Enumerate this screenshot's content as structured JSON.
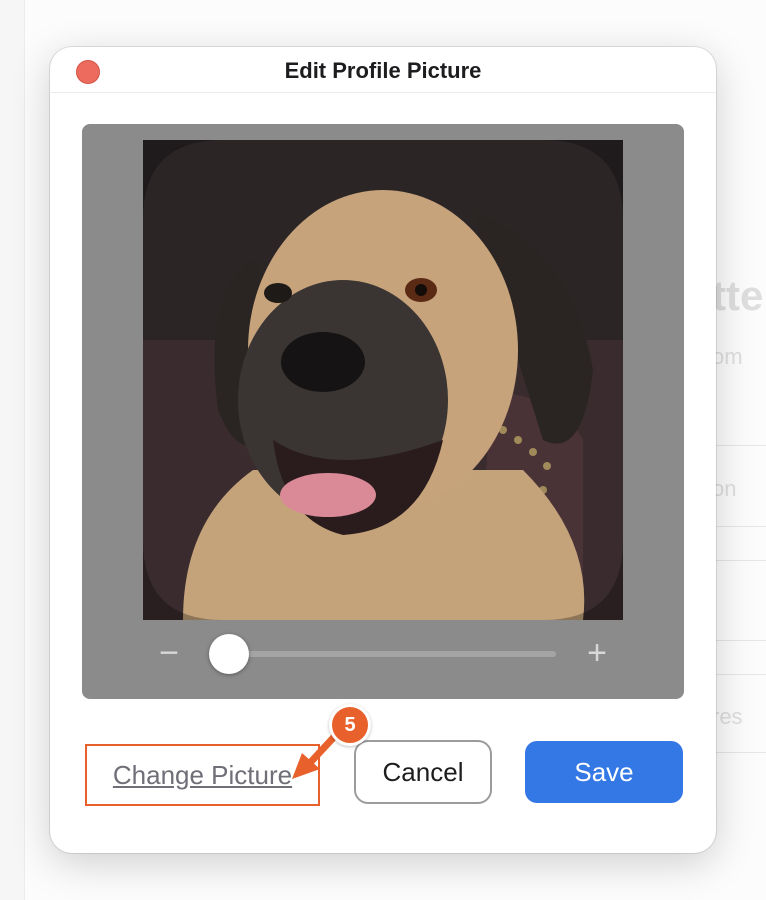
{
  "background": {
    "title_fragment": "tte",
    "subtitle_fragment": "om",
    "items": [
      "on",
      "res"
    ]
  },
  "dialog": {
    "title": "Edit Profile Picture",
    "close_icon": "close-icon",
    "zoom": {
      "minus_label": "−",
      "plus_label": "+",
      "level": 0.07
    },
    "buttons": {
      "change_label": "Change Picture",
      "cancel_label": "Cancel",
      "save_label": "Save"
    }
  },
  "annotation": {
    "step_number": "5",
    "highlight_color": "#e8612c",
    "arrow_icon": "arrow-down-left-icon"
  },
  "colors": {
    "accent": "#3478e6",
    "close": "#ec6a5e",
    "editor_bg": "#8b8b8b"
  }
}
